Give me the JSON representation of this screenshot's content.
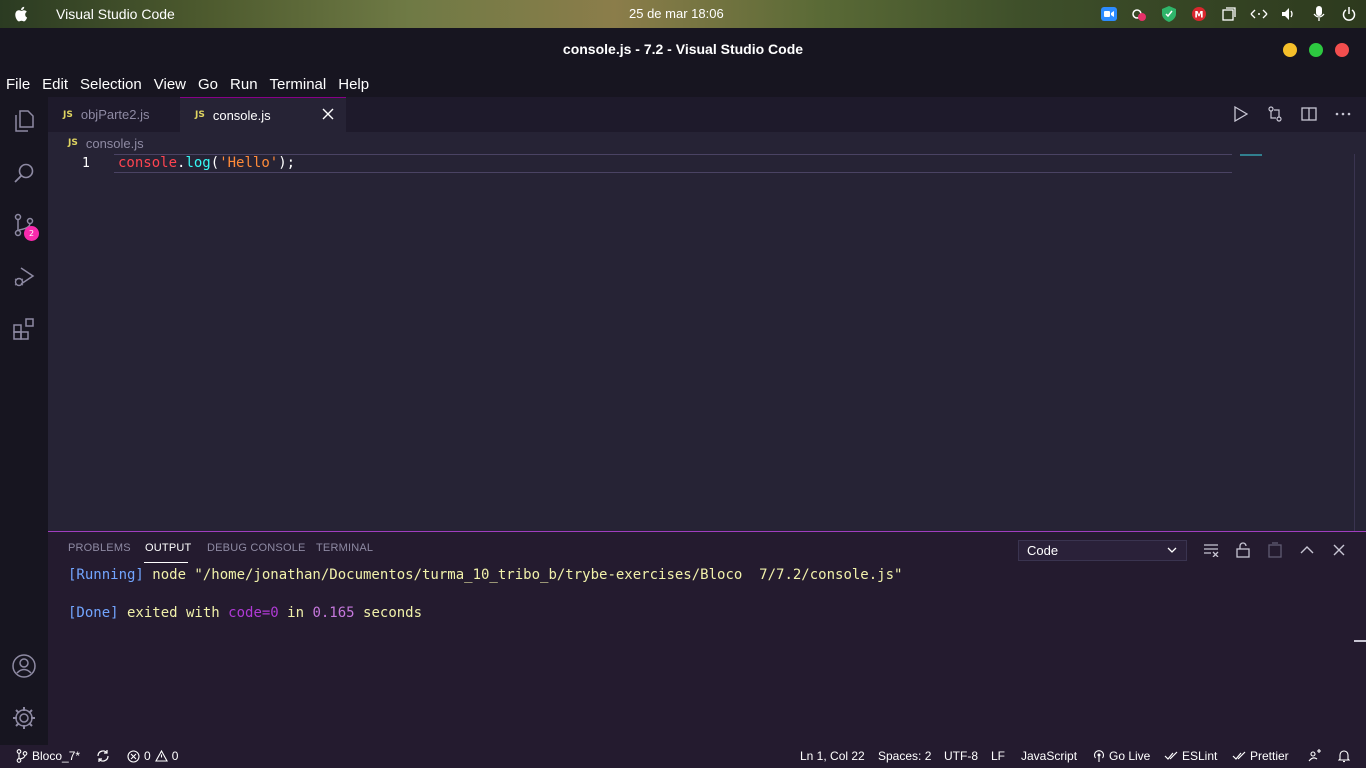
{
  "system": {
    "app_name": "Visual Studio Code",
    "clock": "25 de mar  18:06"
  },
  "window": {
    "title": "console.js - 7.2 - Visual Studio Code"
  },
  "menu": [
    "File",
    "Edit",
    "Selection",
    "View",
    "Go",
    "Run",
    "Terminal",
    "Help"
  ],
  "activity": {
    "scm_badge": "2"
  },
  "tabs": [
    {
      "icon": "JS",
      "label": "objParte2.js"
    },
    {
      "icon": "JS",
      "label": "console.js"
    }
  ],
  "breadcrumb": {
    "icon": "JS",
    "file": "console.js"
  },
  "editor": {
    "line_number": "1",
    "tokens": {
      "obj": "console",
      "dot": ".",
      "fn": "log",
      "open": "(",
      "str": "'Hello'",
      "close": ");"
    }
  },
  "panel": {
    "tabs": [
      "PROBLEMS",
      "OUTPUT",
      "DEBUG CONSOLE",
      "TERMINAL"
    ],
    "selected_output": "Code",
    "line1": {
      "tag": "[Running]",
      "cmd": " node \"/home/jonathan/Documentos/turma_10_tribo_b/trybe-exercises/Bloco  7/7.2/console.js\""
    },
    "line2": {
      "tag": "[Done]",
      "t1": " exited with ",
      "code": "code=0",
      "t2": " in ",
      "num": "0.165",
      "t3": " seconds"
    }
  },
  "status": {
    "branch": "Bloco_7*",
    "errors": "0",
    "warnings": "0",
    "position": "Ln 1, Col 22",
    "spaces": "Spaces: 2",
    "encoding": "UTF-8",
    "eol": "LF",
    "language": "JavaScript",
    "golive": "Go Live",
    "eslint": "ESLint",
    "prettier": "Prettier"
  },
  "colors": {
    "accent": "#a03ebf",
    "badge": "#f92aad"
  }
}
